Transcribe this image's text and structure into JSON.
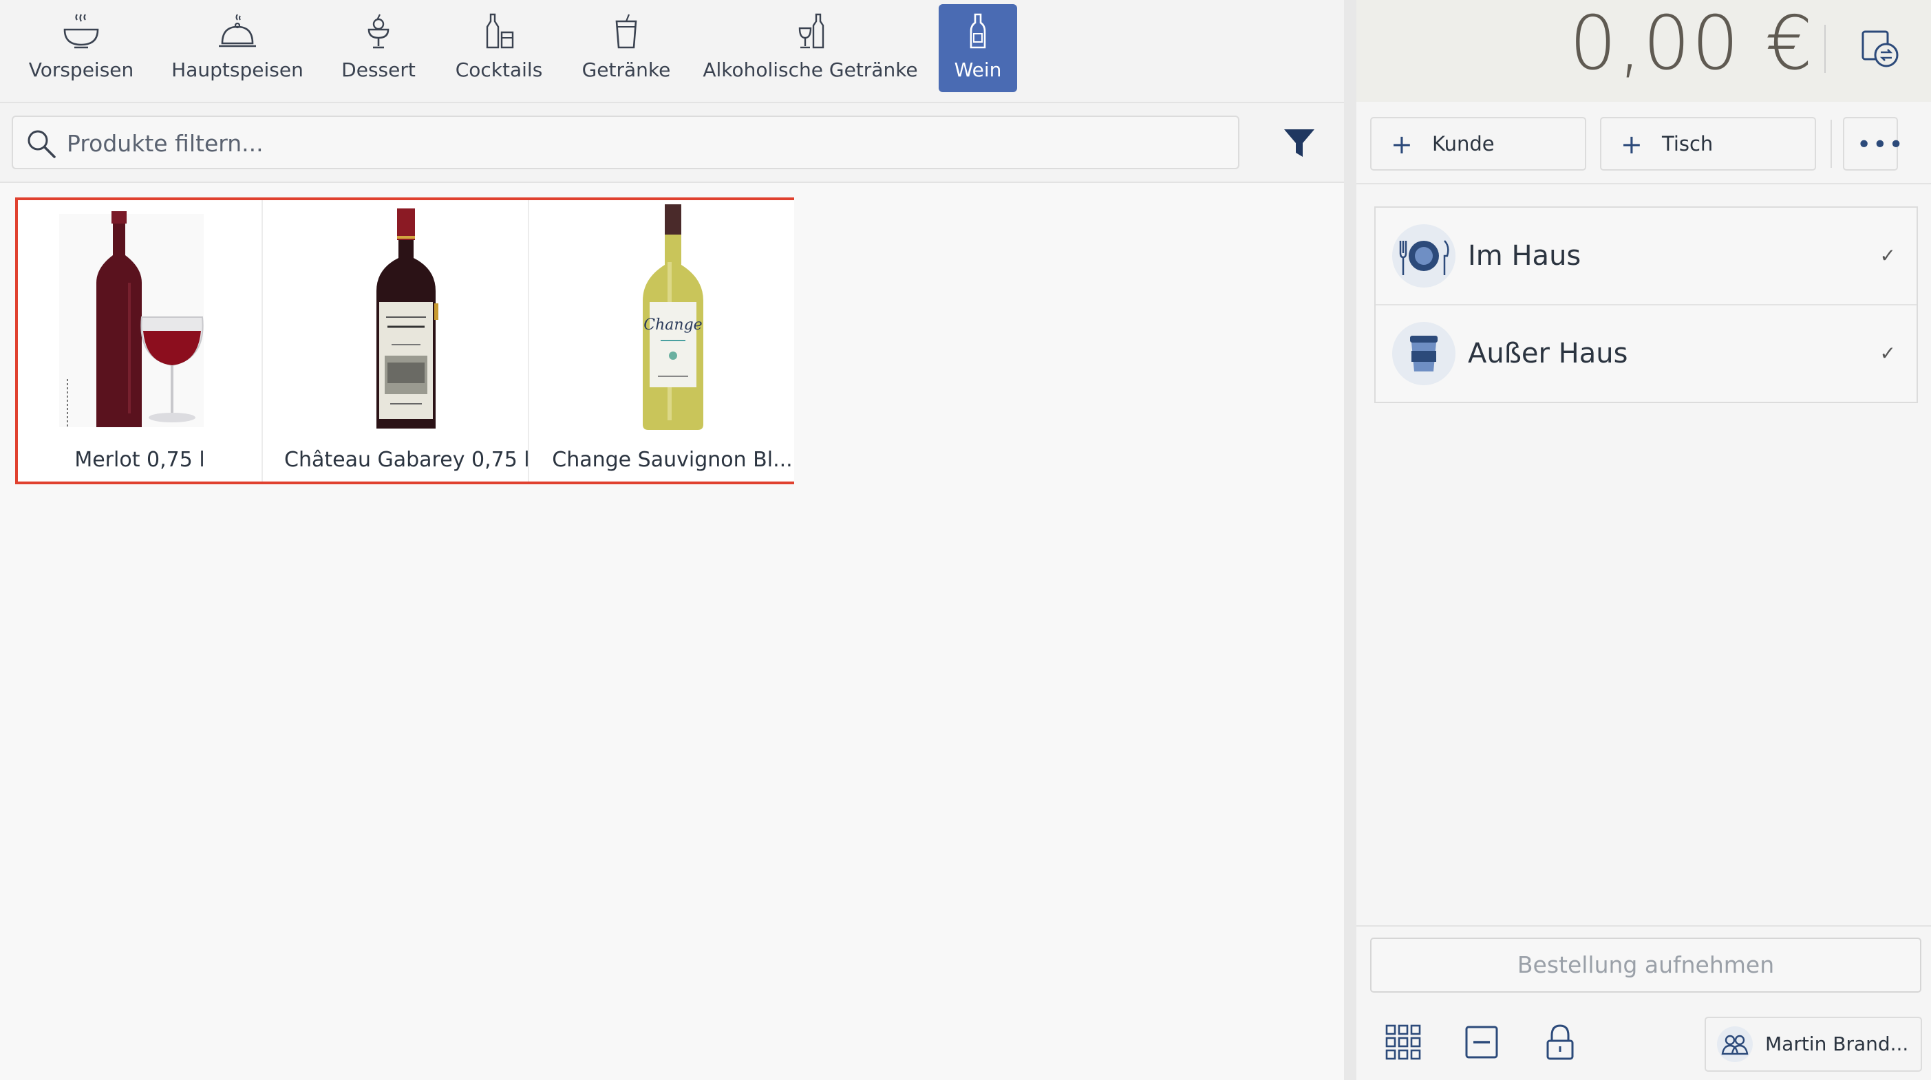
{
  "categories": [
    {
      "label": "Vorspeisen",
      "icon": "bowl-icon",
      "active": false
    },
    {
      "label": "Hauptspeisen",
      "icon": "cloche-icon",
      "active": false
    },
    {
      "label": "Dessert",
      "icon": "ice-cream-cup-icon",
      "active": false
    },
    {
      "label": "Cocktails",
      "icon": "cocktail-bottles-icon",
      "active": false
    },
    {
      "label": "Getränke",
      "icon": "drink-cup-icon",
      "active": false
    },
    {
      "label": "Alkoholische Getränke",
      "icon": "wine-and-glass-icon",
      "active": false
    },
    {
      "label": "Wein",
      "icon": "wine-bottle-icon",
      "active": true
    }
  ],
  "search": {
    "placeholder": "Produkte filtern..."
  },
  "products": [
    {
      "name": "Merlot 0,75 l",
      "image": "red-wine-bottle-with-glass"
    },
    {
      "name": "Château Gabarey 0,75 l",
      "image": "red-wine-bottle"
    },
    {
      "name": "Change Sauvignon Bl...",
      "image": "white-wine-bottle",
      "bottle_label": "Change"
    }
  ],
  "order": {
    "total": "0,00 €",
    "customer_label": "Kunde",
    "table_label": "Tisch",
    "more_label": "•••",
    "modes": [
      {
        "label": "Im Haus",
        "icon": "plate-cutlery-icon",
        "check": "✓"
      },
      {
        "label": "Außer Haus",
        "icon": "takeaway-cup-icon",
        "check": "✓"
      }
    ],
    "submit_label": "Bestellung aufnehmen"
  },
  "footer": {
    "user_name": "Martin Brand..."
  },
  "colors": {
    "accent": "#4a6bb3",
    "highlight_border": "#e0412f",
    "icon_navy": "#2c4a7a"
  }
}
